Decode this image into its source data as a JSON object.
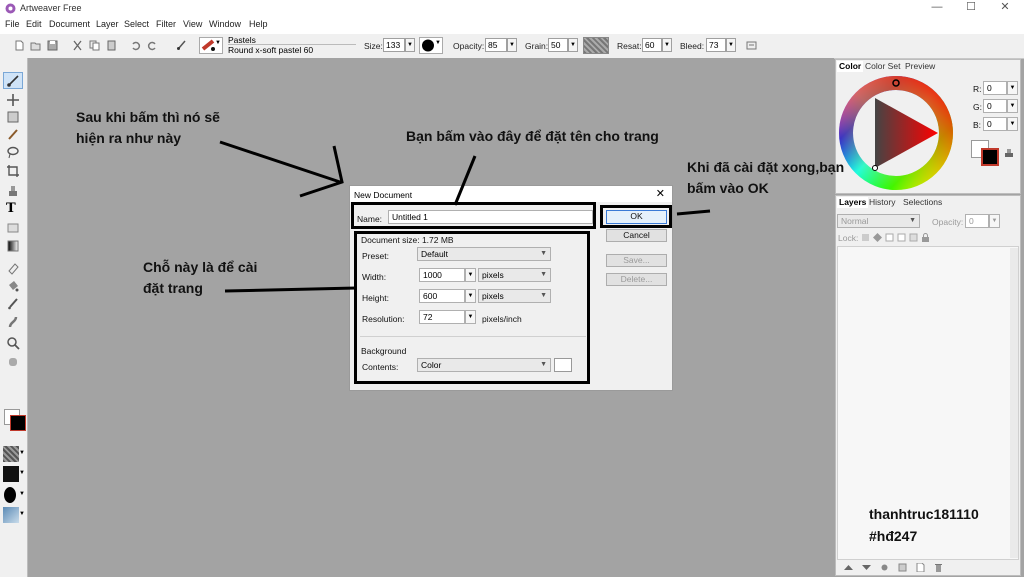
{
  "window": {
    "title": "Artweaver Free",
    "minimize": "—",
    "maximize": "☐",
    "close": "✕"
  },
  "menu": [
    "File",
    "Edit",
    "Document",
    "Layer",
    "Select",
    "Filter",
    "View",
    "Window",
    "Help"
  ],
  "toolbar": {
    "brush_category": "Pastels",
    "brush_variant": "Round x-soft pastel 60",
    "size_label": "Size:",
    "size": "133",
    "opacity_label": "Opacity:",
    "opacity": "85",
    "grain_label": "Grain:",
    "grain": "50",
    "resat_label": "Resat:",
    "resat": "60",
    "bleed_label": "Bleed:",
    "bleed": "73"
  },
  "color_panel": {
    "tabs": [
      "Color",
      "Color Set",
      "Preview"
    ],
    "r_label": "R:",
    "r": "0",
    "g_label": "G:",
    "g": "0",
    "b_label": "B:",
    "b": "0",
    "primary_color": "#000000",
    "secondary_color": "#ffffff"
  },
  "layers_panel": {
    "tabs": [
      "Layers",
      "History",
      "Selections"
    ],
    "mode": "Normal",
    "opacity_label": "Opacity:",
    "opacity": "0",
    "lock_label": "Lock:"
  },
  "dialog": {
    "title": "New Document",
    "name_label": "Name:",
    "name_value": "Untitled 1",
    "doc_size": "Document size: 1.72 MB",
    "preset_label": "Preset:",
    "preset": "Default",
    "width_label": "Width:",
    "width": "1000",
    "width_unit": "pixels",
    "height_label": "Height:",
    "height": "600",
    "height_unit": "pixels",
    "resolution_label": "Resolution:",
    "resolution": "72",
    "resolution_unit": "pixels/inch",
    "background_label": "Background",
    "contents_label": "Contents:",
    "contents": "Color",
    "ok": "OK",
    "cancel": "Cancel",
    "save": "Save...",
    "delete": "Delete..."
  },
  "annotations": {
    "a1_line1": "Sau khi bấm thì nó sẽ",
    "a1_line2": "hiện ra như này",
    "a2": "Bạn bấm vào đây để đặt tên cho trang",
    "a3_line1": "Khi đã cài đặt xong,bạn",
    "a3_line2": "bấm vào OK",
    "a4_line1": "Chỗ này là để cài",
    "a4_line2": "đặt trang"
  },
  "watermark": {
    "line1": "thanhtruc181110",
    "line2": "#hđ247"
  },
  "colors": {
    "canvas_bg": "#a3a3a3",
    "panel_bg": "#f0f0f0",
    "accent_red": "#c0392b"
  }
}
